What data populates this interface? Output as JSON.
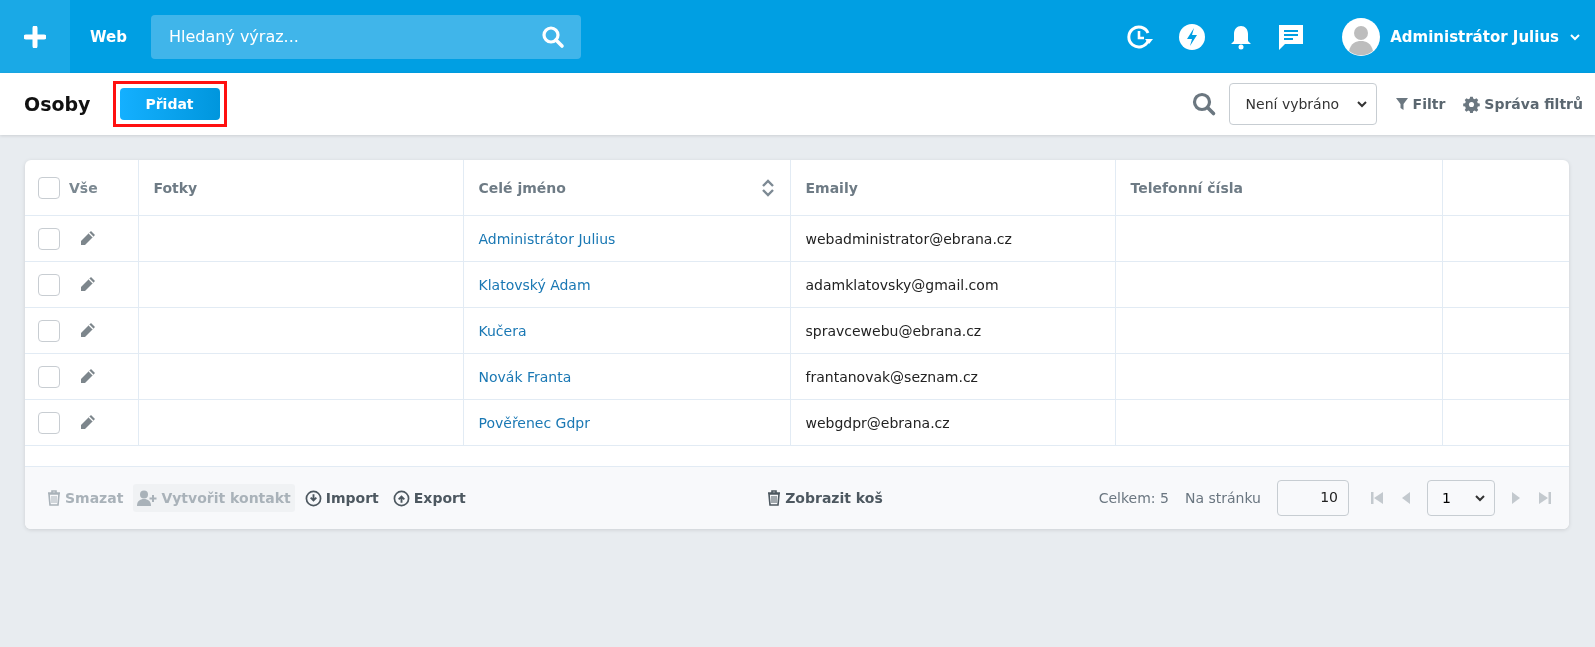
{
  "topbar": {
    "section": "Web",
    "search": {
      "placeholder": "Hledaný výraz..."
    },
    "user": {
      "name": "Administrátor Julius"
    }
  },
  "toolbar": {
    "title": "Osoby",
    "add_button": {
      "label": "Přidat",
      "highlighted": true
    },
    "filter_select": {
      "value": "Není vybráno"
    },
    "filter_link": "Filtr",
    "manage_filters": "Správa filtrů"
  },
  "table": {
    "select_all": {
      "label": "Vše",
      "checked": false
    },
    "columns": [
      {
        "label": "Fotky",
        "sortable": false
      },
      {
        "label": "Celé jméno",
        "sortable": true
      },
      {
        "label": "Emaily",
        "sortable": false
      },
      {
        "label": "Telefonní čísla",
        "sortable": false
      }
    ],
    "rows": [
      {
        "checked": false,
        "name": "Administrátor Julius",
        "email": "webadministrator@ebrana.cz"
      },
      {
        "checked": false,
        "name": "Klatovský Adam",
        "email": "adamklatovsky@gmail.com"
      },
      {
        "checked": false,
        "name": "Kučera",
        "email": "spravcewebu@ebrana.cz"
      },
      {
        "checked": false,
        "name": "Novák Franta",
        "email": "frantanovak@seznam.cz"
      },
      {
        "checked": false,
        "name": "Pověřenec Gdpr",
        "email": "webgdpr@ebrana.cz"
      }
    ]
  },
  "footer": {
    "actions": [
      {
        "kind": "trash",
        "label": "Smazat",
        "disabled": true
      },
      {
        "kind": "contact",
        "label": "Vytvořit kontakt",
        "disabled": true
      },
      {
        "kind": "import",
        "label": "Import",
        "disabled": false
      },
      {
        "kind": "export",
        "label": "Export",
        "disabled": false
      }
    ],
    "trash_link": "Zobrazit koš",
    "total": "Celkem: 5",
    "per_page_label": "Na stránku",
    "per_page": "10",
    "page": "1"
  }
}
